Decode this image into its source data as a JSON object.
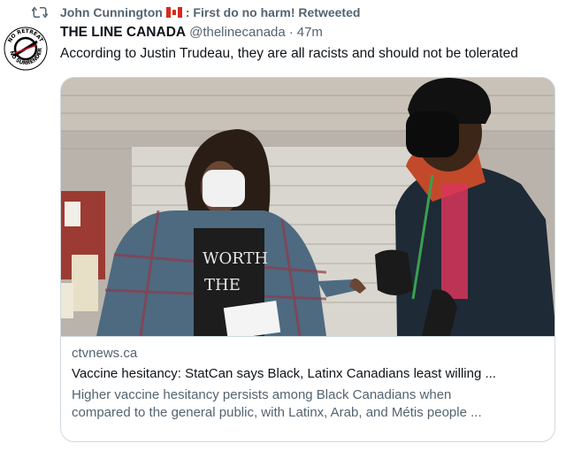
{
  "retweet": {
    "icon": "retweet-icon",
    "name": "John Cunnington",
    "flag_icon": "canada-flag-icon",
    "suffix": ": First do no harm! Retweeted"
  },
  "tweet": {
    "avatar_text_top": "NO RETREAT",
    "avatar_text_bottom": "NO SURRENDER",
    "display_name": "THE LINE CANADA",
    "handle": "@thelinecanada",
    "separator": "·",
    "time": "47m",
    "text": "According to Justin Trudeau, they are all racists and should not be tolerated"
  },
  "card": {
    "domain": "ctvnews.ca",
    "title": "Vaccine hesitancy: StatCan says Black, Latinx Canadians least willing ...",
    "description_line1": "Higher vaccine hesitancy persists among Black Canadians when",
    "description_line2": "compared to the general public, with Latinx, Arab, and Métis people ...",
    "image_text_1": "WORTH",
    "image_text_2": "THE"
  },
  "colors": {
    "text": "#0f1419",
    "secondary": "#536471",
    "border": "#cfd9de"
  }
}
